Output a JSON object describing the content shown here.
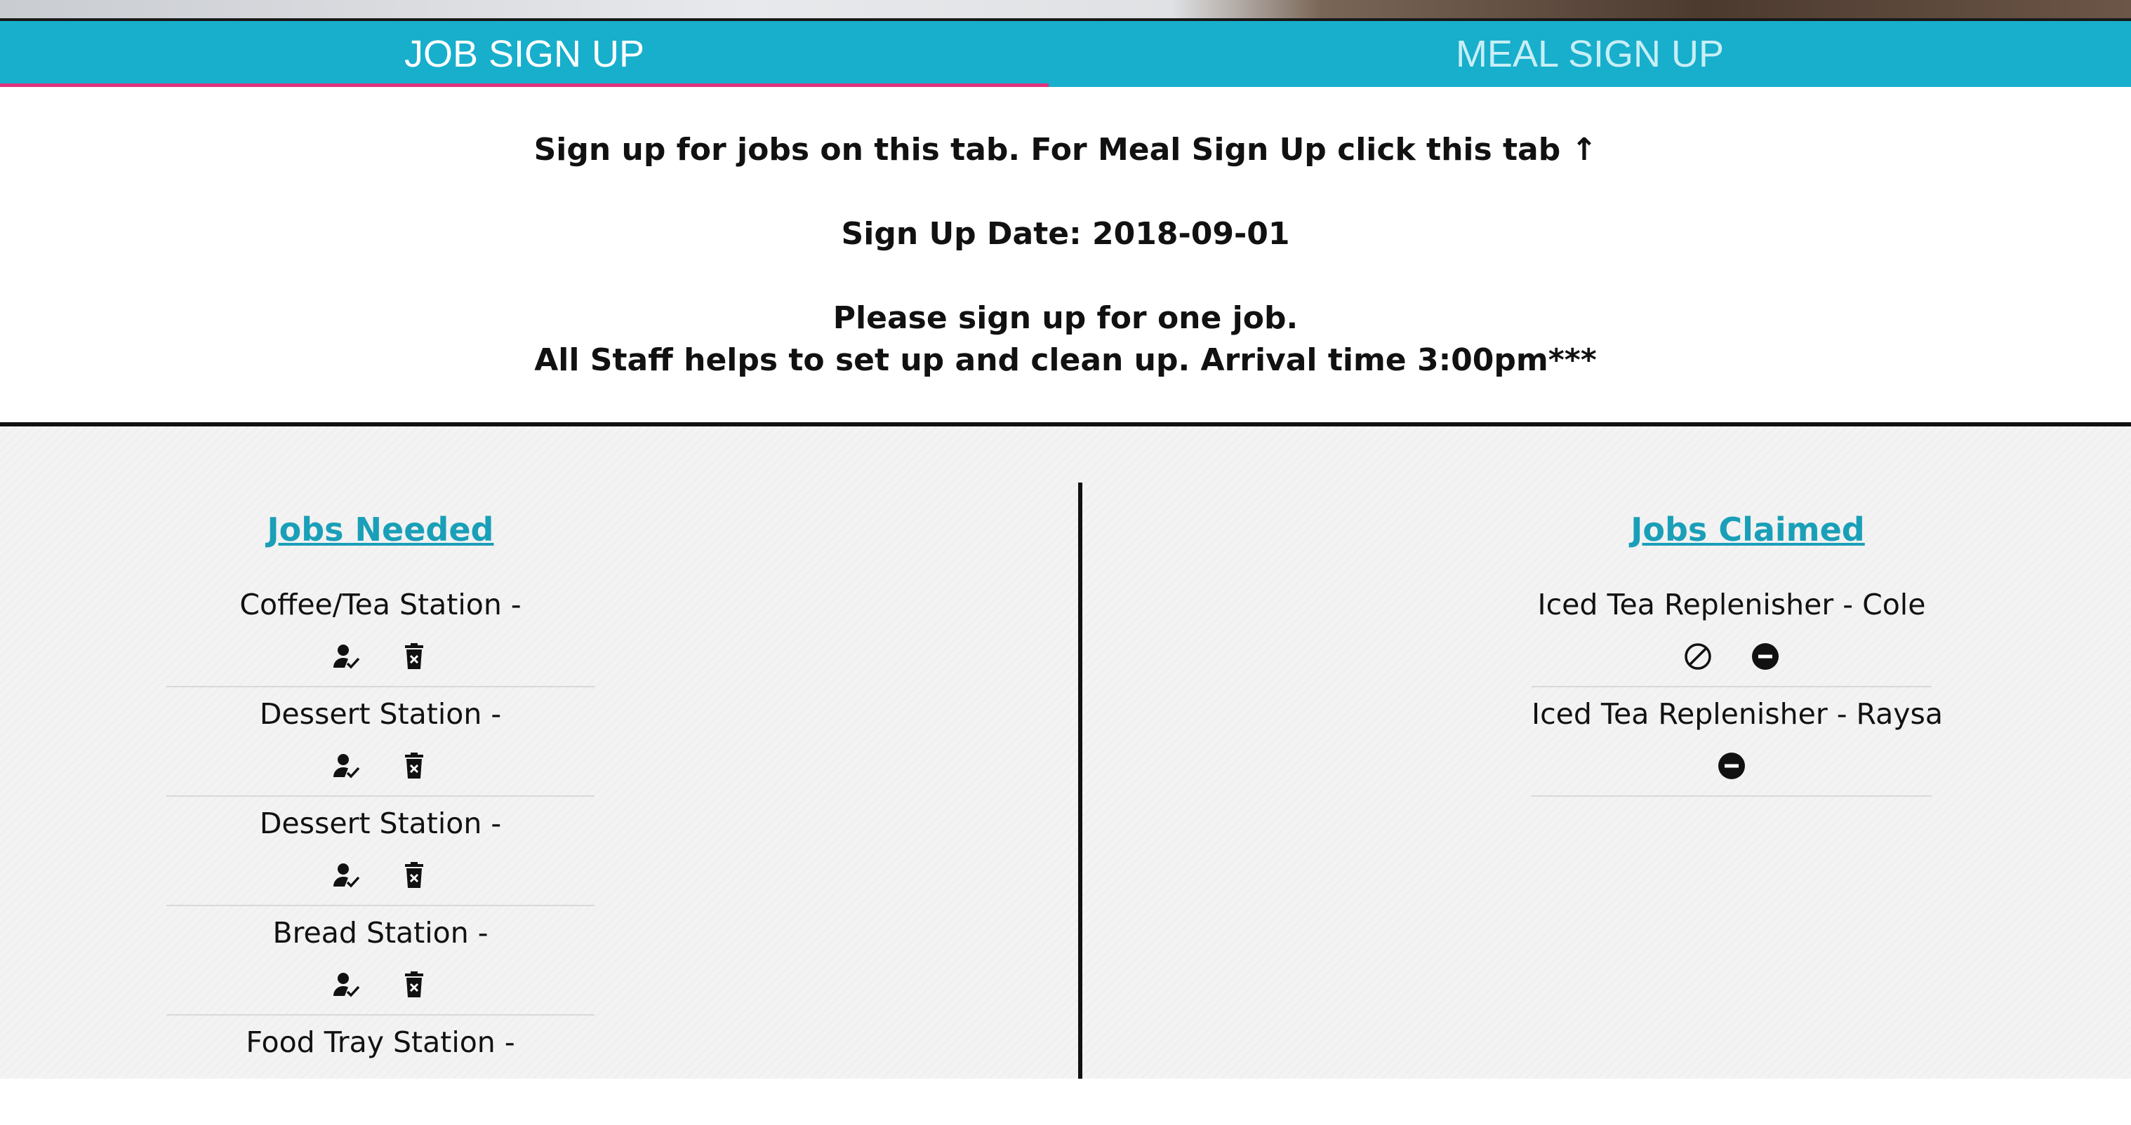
{
  "tabs": [
    {
      "label": "JOB SIGN UP"
    },
    {
      "label": "MEAL SIGN UP"
    }
  ],
  "intro": {
    "line1": "Sign up for jobs on this tab. For Meal Sign Up click this tab ↑",
    "line2": "Sign Up Date: 2018-09-01",
    "line3": "Please sign up for one job.",
    "line4": "All Staff helps to set up and clean up. Arrival time 3:00pm***"
  },
  "jobs_needed": {
    "title": "Jobs Needed",
    "items": [
      {
        "name": "Coffee/Tea Station -",
        "actions": [
          "claim-person-icon",
          "delete-trash-icon"
        ]
      },
      {
        "name": "Dessert Station -",
        "actions": [
          "claim-person-icon",
          "delete-trash-icon"
        ]
      },
      {
        "name": "Dessert Station -",
        "actions": [
          "claim-person-icon",
          "delete-trash-icon"
        ]
      },
      {
        "name": "Bread Station -",
        "actions": [
          "claim-person-icon",
          "delete-trash-icon"
        ]
      },
      {
        "name": "Food Tray Station -",
        "actions": []
      }
    ]
  },
  "jobs_claimed": {
    "title": "Jobs Claimed",
    "items": [
      {
        "name": "Iced Tea Replenisher - Cole",
        "actions": [
          "block-icon",
          "remove-circle-icon"
        ]
      },
      {
        "name": "Iced Tea Replenisher - Raysa",
        "actions": [
          "remove-circle-icon"
        ]
      }
    ]
  },
  "colors": {
    "tab_bar": "#17afcc",
    "active_tab_indicator": "#e2317d",
    "title_link": "#1a9fb8"
  }
}
